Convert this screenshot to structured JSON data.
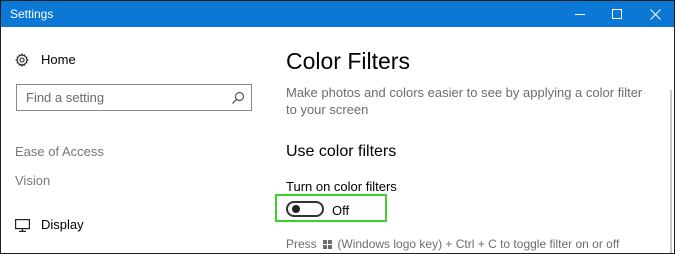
{
  "window": {
    "title": "Settings",
    "title_bar_color": "#0a78d4",
    "controls": [
      "minimize-icon",
      "maximize-icon",
      "close-icon"
    ]
  },
  "sidebar": {
    "home_label": "Home",
    "home_icon": "gear-icon",
    "search_placeholder": "Find a setting",
    "search_icon": "search-icon",
    "section_title": "Ease of Access",
    "group_title": "Vision",
    "items": [
      {
        "label": "Display",
        "icon": "monitor-icon"
      }
    ]
  },
  "main": {
    "title": "Color Filters",
    "description": "Make photos and colors easier to see by applying a color filter to your screen",
    "section_heading": "Use color filters",
    "toggle": {
      "label": "Turn on color filters",
      "state_text": "Off",
      "on": false
    },
    "shortcut_hint": {
      "prefix": "Press",
      "icon": "windows-logo-icon",
      "suffix": "(Windows logo key) + Ctrl + C to toggle filter on or off"
    },
    "highlight_color": "#3bd12b"
  }
}
